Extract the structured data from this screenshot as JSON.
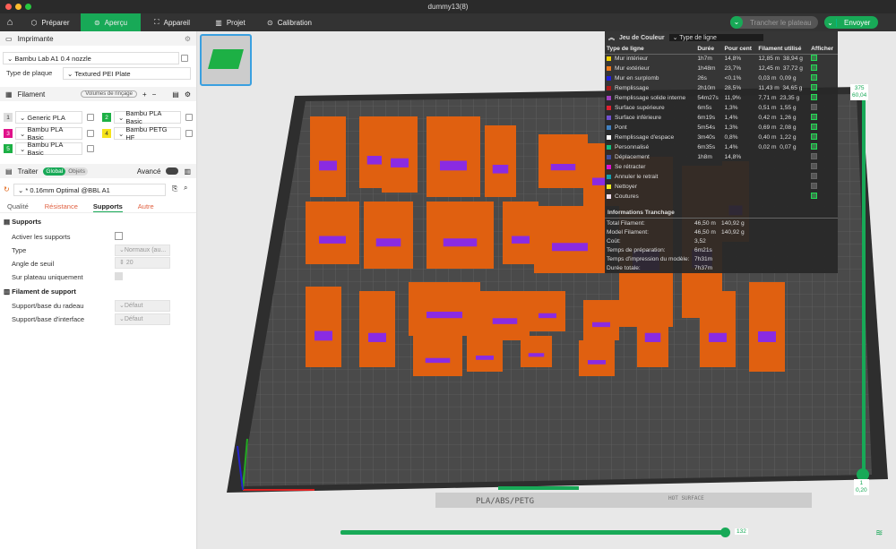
{
  "window": {
    "title": "dummy13(8)"
  },
  "nav": {
    "home": "home",
    "tabs": [
      {
        "label": "Préparer",
        "icon": "cube-icon"
      },
      {
        "label": "Aperçu",
        "icon": "preview-icon",
        "active": true
      },
      {
        "label": "Appareil",
        "icon": "device-icon"
      },
      {
        "label": "Projet",
        "icon": "project-icon"
      },
      {
        "label": "Calibration",
        "icon": "calibration-icon"
      }
    ],
    "slice_label": "Trancher le plateau",
    "send_label": "Envoyer"
  },
  "printer": {
    "section": "Imprimante",
    "name": "Bambu Lab A1 0.4 nozzle",
    "plate_type_label": "Type de plaque",
    "plate_type": "Textured PEI Plate"
  },
  "filament": {
    "section": "Filament",
    "flush_label": "Volumes de rinçage",
    "items": [
      {
        "n": "1",
        "name": "Generic PLA",
        "color": "#d8d8d8"
      },
      {
        "n": "2",
        "name": "Bambu PLA Basic",
        "color": "#1db045"
      },
      {
        "n": "3",
        "name": "Bambu PLA Basic",
        "color": "#e0128a"
      },
      {
        "n": "4",
        "name": "Bambu PETG HF",
        "color": "#f5e31a"
      },
      {
        "n": "5",
        "name": "Bambu PLA Basic",
        "color": "#1db045"
      }
    ]
  },
  "process": {
    "section": "Traiter",
    "global": "Global",
    "objects": "Objets",
    "advanced": "Avancé",
    "preset": "* 0.16mm Optimal @BBL A1",
    "tabs": [
      "Qualité",
      "Résistance",
      "Supports",
      "Autre"
    ],
    "active_tab": "Supports"
  },
  "supports": {
    "title": "Supports",
    "enable": "Activer les supports",
    "type_label": "Type",
    "type_value": "Normaux (au...",
    "angle_label": "Angle de seuil",
    "angle_value": "20",
    "build_plate_only": "Sur plateau uniquement",
    "filament_title": "Filament de support",
    "raft_label": "Support/base du radeau",
    "raft_value": "Défaut",
    "interface_label": "Support/base d'interface",
    "interface_value": "Défaut"
  },
  "legend": {
    "title": "Jeu de Couleur",
    "view_type": "Type de ligne",
    "headers": [
      "Type de ligne",
      "Durée",
      "Pour cent",
      "Filament utilisé",
      "Afficher"
    ],
    "rows": [
      {
        "name": "Mur intérieur",
        "color": "#f0d000",
        "time": "1h7m",
        "pct": "14,8%",
        "len": "12,85 m",
        "wt": "38,94 g",
        "show": true
      },
      {
        "name": "Mur extérieur",
        "color": "#f07a1a",
        "time": "1h48m",
        "pct": "23,7%",
        "len": "12,45 m",
        "wt": "37,72 g",
        "show": true
      },
      {
        "name": "Mur en surplomb",
        "color": "#2020e0",
        "time": "26s",
        "pct": "<0.1%",
        "len": "0,03 m",
        "wt": "0,09 g",
        "show": true
      },
      {
        "name": "Remplissage",
        "color": "#b01818",
        "time": "2h10m",
        "pct": "28,5%",
        "len": "11,43 m",
        "wt": "34,65 g",
        "show": true
      },
      {
        "name": "Remplissage solide interne",
        "color": "#a040c0",
        "time": "54m27s",
        "pct": "11,9%",
        "len": "7,71 m",
        "wt": "23,35 g",
        "show": true
      },
      {
        "name": "Surface supérieure",
        "color": "#e02030",
        "time": "6m5s",
        "pct": "1,3%",
        "len": "0,51 m",
        "wt": "1,55 g",
        "show": false
      },
      {
        "name": "Surface inférieure",
        "color": "#7050d0",
        "time": "6m19s",
        "pct": "1,4%",
        "len": "0,42 m",
        "wt": "1,26 g",
        "show": true
      },
      {
        "name": "Pont",
        "color": "#4080c0",
        "time": "5m54s",
        "pct": "1,3%",
        "len": "0,69 m",
        "wt": "2,08 g",
        "show": true
      },
      {
        "name": "Remplissage d'espace",
        "color": "#ffffff",
        "time": "3m40s",
        "pct": "0,8%",
        "len": "0,40 m",
        "wt": "1,22 g",
        "show": true
      },
      {
        "name": "Personnalisé",
        "color": "#10c080",
        "time": "6m35s",
        "pct": "1,4%",
        "len": "0,02 m",
        "wt": "0,07 g",
        "show": true
      },
      {
        "name": "Déplacement",
        "color": "#4050a0",
        "time": "1h8m",
        "pct": "14,8%",
        "len": "",
        "wt": "",
        "show": false
      },
      {
        "name": "Se rétracter",
        "color": "#e010d0",
        "time": "",
        "pct": "",
        "len": "",
        "wt": "",
        "show": false
      },
      {
        "name": "Annuler le retrait",
        "color": "#10a0b0",
        "time": "",
        "pct": "",
        "len": "",
        "wt": "",
        "show": false
      },
      {
        "name": "Nettoyer",
        "color": "#f0f020",
        "time": "",
        "pct": "",
        "len": "",
        "wt": "",
        "show": false
      },
      {
        "name": "Coutures",
        "color": "#f0e0f0",
        "time": "",
        "pct": "",
        "len": "",
        "wt": "",
        "show": true
      }
    ]
  },
  "slice_info": {
    "title": "Informations Tranchage",
    "rows": [
      {
        "label": "Total Filament:",
        "v1": "46,50 m",
        "v2": "140,92 g"
      },
      {
        "label": "Model Filament:",
        "v1": "46,50 m",
        "v2": "140,92 g"
      },
      {
        "label": "Coût:",
        "v1": "3,52",
        "v2": ""
      },
      {
        "label": "Temps de préparation:",
        "v1": "6m21s",
        "v2": ""
      },
      {
        "label": "Temps d'impression du modèle:",
        "v1": "7h31m",
        "v2": ""
      },
      {
        "label": "Durée totale:",
        "v1": "7h37m",
        "v2": ""
      }
    ]
  },
  "layer_slider": {
    "top_layer": "375",
    "top_height": "60,04",
    "bottom_layer": "1",
    "bottom_height": "0,20"
  },
  "move_slider": {
    "value": "132",
    "fraction": 1.0
  },
  "plate": {
    "label": "PLA/ABS/PETG",
    "hot": "HOT SURFACE",
    "side_text": "Textured PEI Plate"
  },
  "colors": {
    "accent": "#18a957",
    "model": "#e06010",
    "inner": "#8a2be2"
  }
}
